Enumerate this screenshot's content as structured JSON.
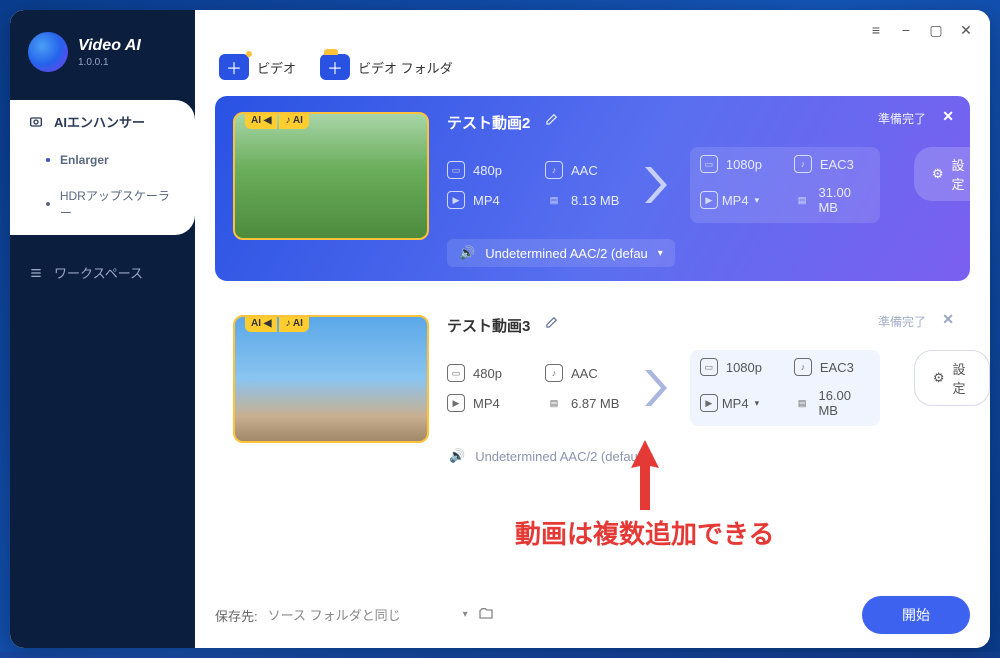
{
  "app": {
    "name": "Video AI",
    "version": "1.0.0.1"
  },
  "sidebar": {
    "enhancer_label": "AIエンハンサー",
    "items": [
      {
        "label": "Enlarger"
      },
      {
        "label": "HDRアップスケーラー"
      }
    ],
    "workspace_label": "ワークスペース"
  },
  "toolbar": {
    "add_video": "ビデオ",
    "add_folder": "ビデオ フォルダ"
  },
  "cards": [
    {
      "title": "テスト動画2",
      "status": "準備完了",
      "in": {
        "res": "480p",
        "audio": "AAC",
        "container": "MP4",
        "size": "8.13 MB"
      },
      "out": {
        "res": "1080p",
        "audio": "EAC3",
        "container": "MP4",
        "size": "31.00 MB"
      },
      "audio_track": "Undetermined AAC/2 (defau",
      "settings_label": "設定"
    },
    {
      "title": "テスト動画3",
      "status": "準備完了",
      "in": {
        "res": "480p",
        "audio": "AAC",
        "container": "MP4",
        "size": "6.87 MB"
      },
      "out": {
        "res": "1080p",
        "audio": "EAC3",
        "container": "MP4",
        "size": "16.00 MB"
      },
      "audio_track": "Undetermined AAC/2 (defau",
      "settings_label": "設定"
    }
  ],
  "annotation": "動画は複数追加できる",
  "bottom": {
    "save_label": "保存先:",
    "save_value": "ソース フォルダと同じ",
    "start_label": "開始"
  }
}
